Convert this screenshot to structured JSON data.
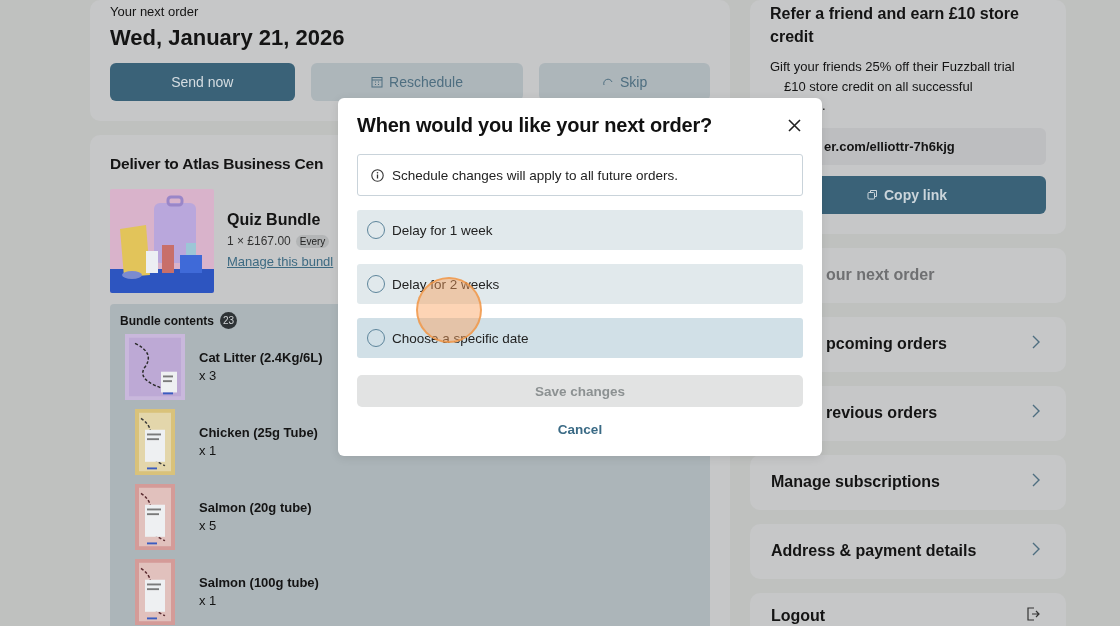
{
  "next_order": {
    "label": "Your next order",
    "date": "Wed, January 21, 2026",
    "buttons": [
      {
        "label": "Send now",
        "kind": "primary"
      },
      {
        "label": "Reschedule",
        "kind": "calendar"
      },
      {
        "label": "Skip",
        "kind": "skip"
      }
    ]
  },
  "delivery": {
    "title": "Deliver to Atlas Business Cen",
    "product": {
      "name": "Quiz Bundle",
      "price": "1 × £167.00",
      "frequency": "Every",
      "link": "Manage this bundl"
    },
    "contents": {
      "title": "Bundle contents",
      "count": "23",
      "items": [
        {
          "name": "Cat Litter (2.4Kg/6L)",
          "quantity": "x 3"
        },
        {
          "name": "Chicken (25g Tube)",
          "quantity": "x 1"
        },
        {
          "name": "Salmon (20g tube)",
          "quantity": "x 5"
        },
        {
          "name": "Salmon (100g tube)",
          "quantity": "x 1"
        }
      ]
    }
  },
  "referral": {
    "title": "Refer a friend and earn £10 store credit",
    "body_lines": [
      "Gift your friends 25% off their Fuzzball trial",
      "£10 store credit on all successful",
      "."
    ],
    "link": "er.com/elliottr-7h6kjg",
    "button": "Copy link"
  },
  "nav": [
    {
      "label": "our next order",
      "kind": "plain",
      "disabled": true
    },
    {
      "label": "pcoming orders",
      "kind": "chevron",
      "disabled": false
    },
    {
      "label": "revious orders",
      "kind": "chevron",
      "disabled": false
    },
    {
      "label": "Manage subscriptions",
      "kind": "chevron",
      "disabled": false
    },
    {
      "label": "Address & payment details",
      "kind": "chevron",
      "disabled": false
    },
    {
      "label": "Logout",
      "kind": "logout",
      "disabled": false
    }
  ],
  "modal": {
    "title": "When would you like your next order?",
    "notice": "Schedule changes will apply to all future orders.",
    "options": [
      {
        "label": "Delay for 1 week",
        "selected": false,
        "hovered": false
      },
      {
        "label": "Delay for 2 weeks",
        "selected": false,
        "hovered": false
      },
      {
        "label": "Choose a specific date",
        "selected": false,
        "hovered": true
      }
    ],
    "save": {
      "label": "Save changes",
      "disabled": true
    },
    "cancel": "Cancel"
  }
}
